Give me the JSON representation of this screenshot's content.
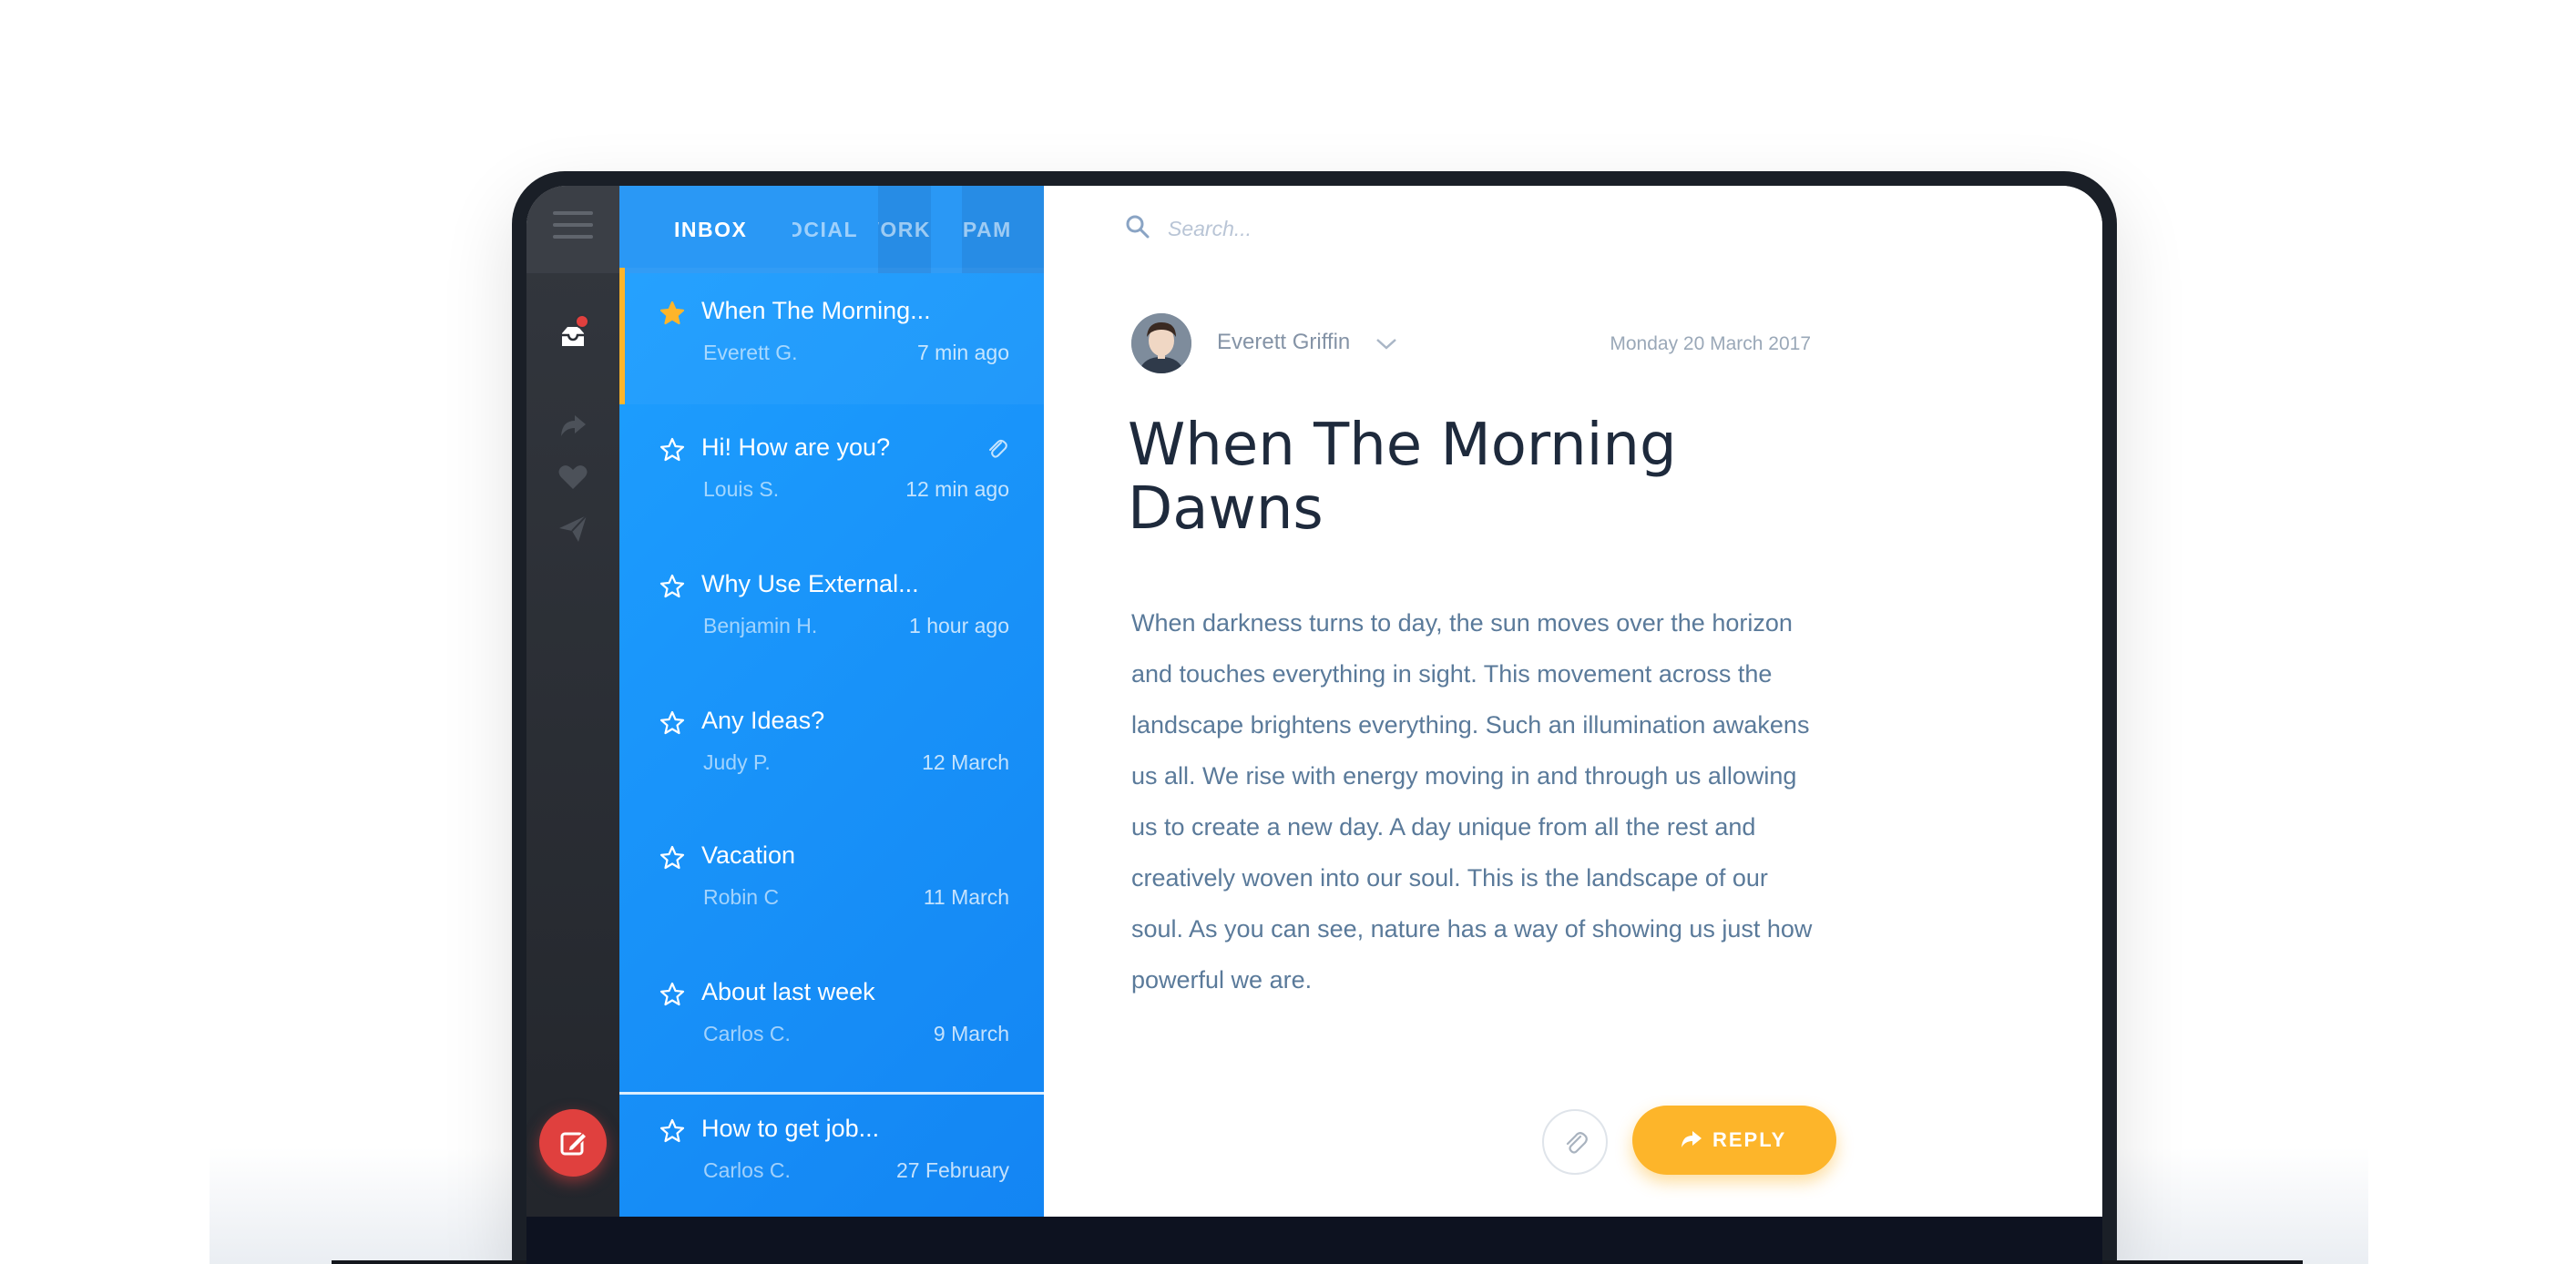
{
  "colors": {
    "rail": "#2a2e35",
    "list_gradient_start": "#1ea0ff",
    "list_gradient_end": "#1385f3",
    "accent": "#fdb52a",
    "compose": "#e0403e",
    "title": "#1e2a3c",
    "body": "#5a7a9a"
  },
  "rail": {
    "menu_icon": "hamburger-icon",
    "items": [
      {
        "icon": "inbox-icon",
        "active": true,
        "has_notification": true
      },
      {
        "icon": "forward-icon",
        "active": false
      },
      {
        "icon": "heart-icon",
        "active": false
      },
      {
        "icon": "send-icon",
        "active": false
      }
    ],
    "compose_icon": "edit-icon"
  },
  "tabs": [
    {
      "label": "INBOX",
      "active": true
    },
    {
      "label": "SOCIAL",
      "active": false
    },
    {
      "label": "WORK",
      "active": false
    },
    {
      "label": "SPAM",
      "active": false
    }
  ],
  "mails": [
    {
      "subject": "When The Morning...",
      "sender": "Everett G.",
      "time": "7 min ago",
      "starred": true,
      "active": true,
      "attachment": false
    },
    {
      "subject": "Hi! How are you?",
      "sender": "Louis S.",
      "time": "12 min ago",
      "starred": false,
      "active": false,
      "attachment": true
    },
    {
      "subject": "Why Use External...",
      "sender": "Benjamin H.",
      "time": "1 hour ago",
      "starred": false,
      "active": false,
      "attachment": false
    },
    {
      "subject": "Any Ideas?",
      "sender": "Judy P.",
      "time": "12 March",
      "starred": false,
      "active": false,
      "attachment": false
    },
    {
      "subject": "Vacation",
      "sender": "Robin C",
      "time": "11 March",
      "starred": false,
      "active": false,
      "attachment": false
    },
    {
      "subject": "About last week",
      "sender": "Carlos C.",
      "time": "9 March",
      "starred": false,
      "active": false,
      "attachment": false
    },
    {
      "subject": "How to get job...",
      "sender": "Carlos C.",
      "time": "27 February",
      "starred": false,
      "active": false,
      "attachment": false
    }
  ],
  "search": {
    "placeholder": "Search...",
    "value": ""
  },
  "message": {
    "from": "Everett Griffin",
    "date": "Monday 20 March 2017",
    "title_line1": "When The Morning",
    "title_line2": "Dawns",
    "body": "When darkness turns to day, the sun moves over the horizon and touches everything in sight. This movement across the landscape brightens everything. Such an illumination awakens us all. We rise with energy moving in and through us allowing us to create a new day. A day unique from all the rest and creatively woven into our soul. This is the landscape of our soul. As you can see, nature has a way of showing us just how powerful we are."
  },
  "actions": {
    "attach_icon": "paperclip-icon",
    "reply_icon": "reply-arrow-icon",
    "reply_label": "REPLY"
  }
}
